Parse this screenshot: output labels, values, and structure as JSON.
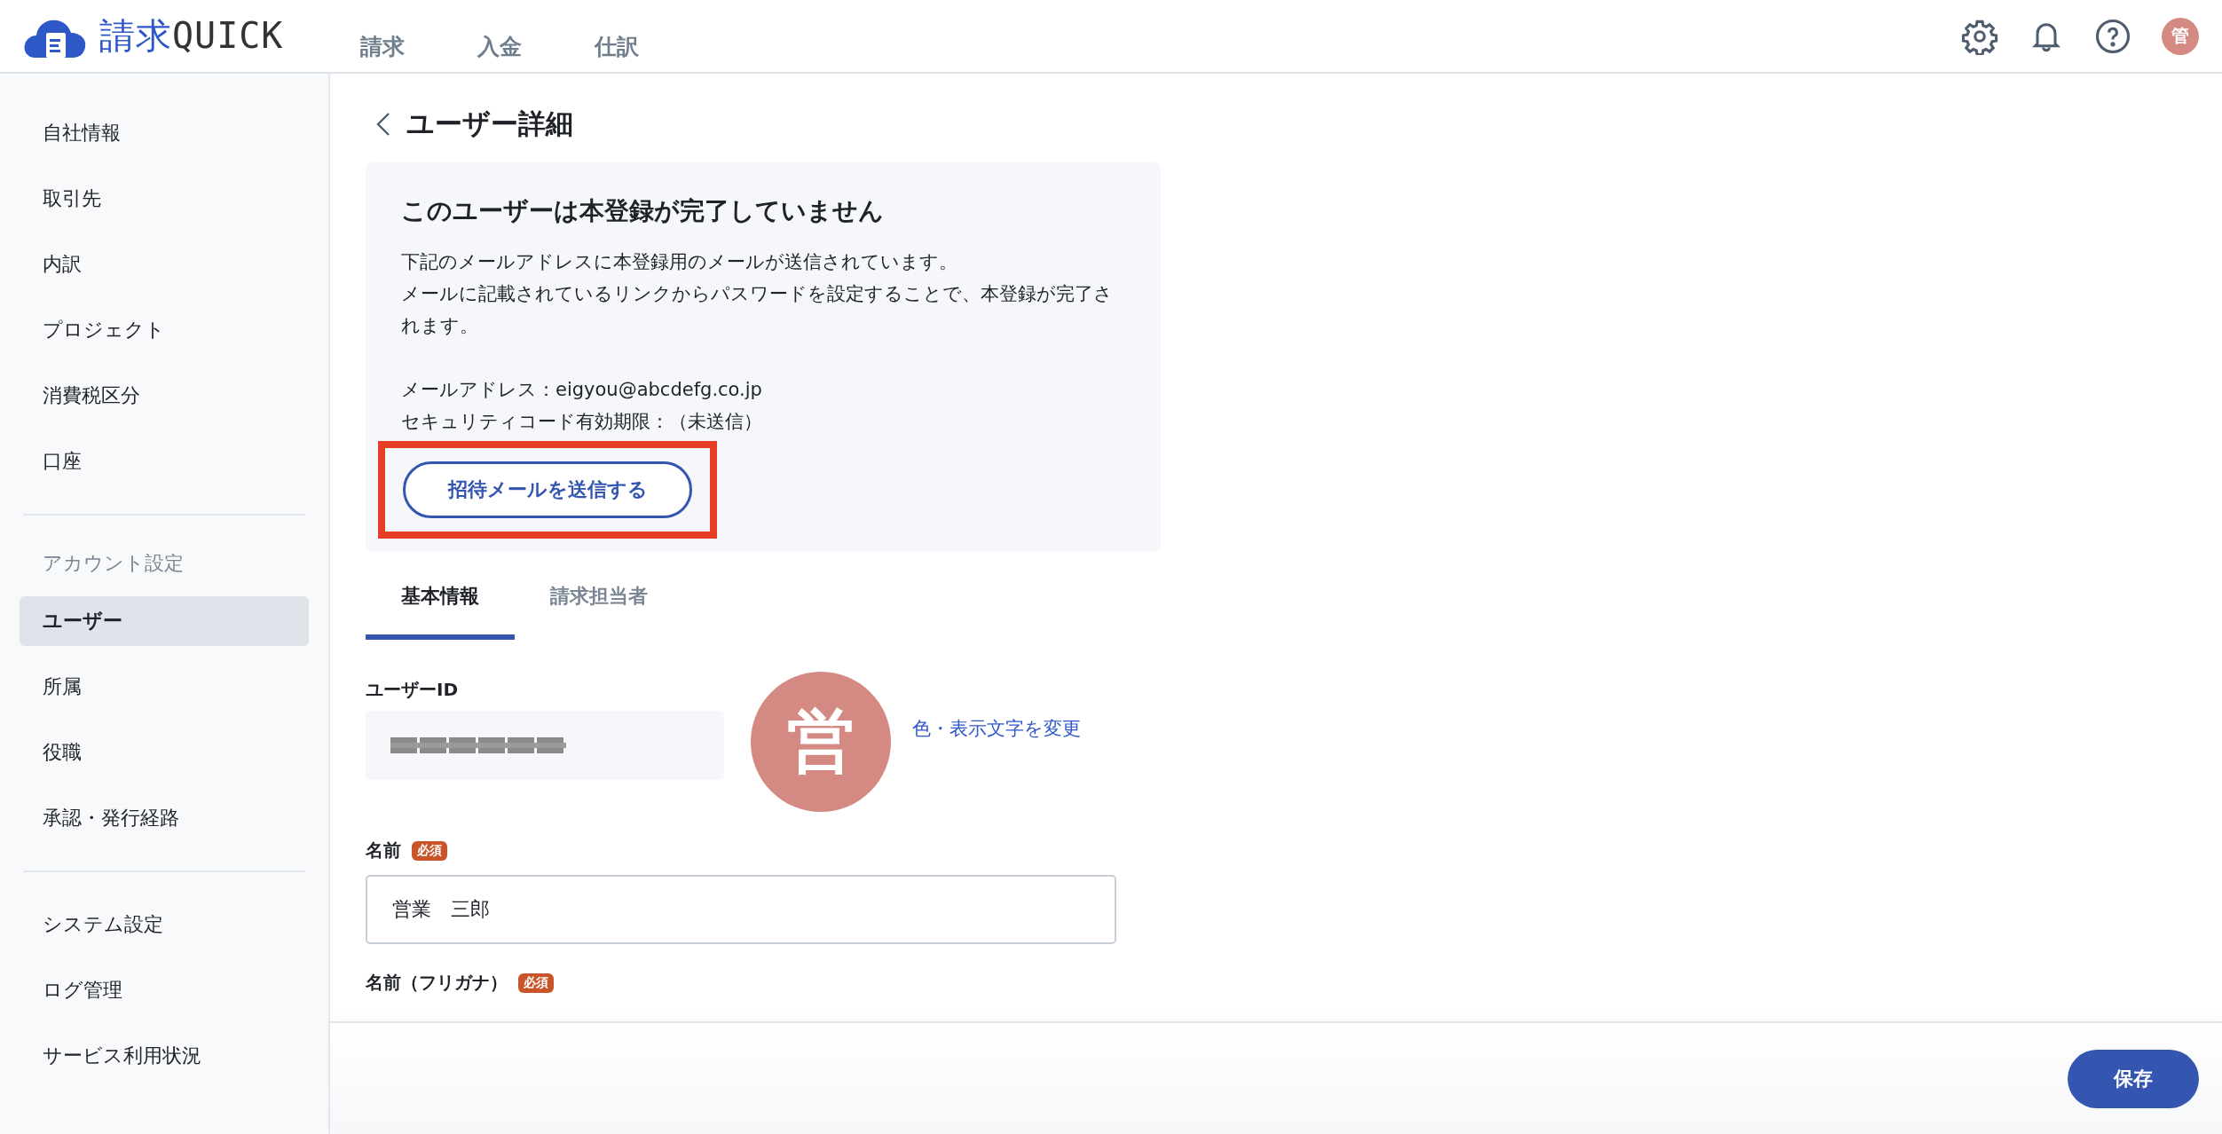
{
  "app": {
    "logo_text_1": "請求",
    "logo_text_2": "QUICK",
    "avatar": "管"
  },
  "nav": [
    {
      "label": "請求",
      "selected": false
    },
    {
      "label": "入金",
      "selected": false
    },
    {
      "label": "仕訳",
      "selected": false
    }
  ],
  "sidebar": {
    "groups": [
      {
        "items": [
          {
            "label": "自社情報",
            "selected": false
          },
          {
            "label": "取引先",
            "selected": false
          },
          {
            "label": "内訳",
            "selected": false
          },
          {
            "label": "プロジェクト",
            "selected": false
          },
          {
            "label": "消費税区分",
            "selected": false
          },
          {
            "label": "口座",
            "selected": false
          }
        ]
      },
      {
        "heading": "アカウント設定",
        "items": [
          {
            "label": "ユーザー",
            "selected": true
          },
          {
            "label": "所属",
            "selected": false
          },
          {
            "label": "役職",
            "selected": false
          },
          {
            "label": "承認・発行経路",
            "selected": false
          }
        ]
      },
      {
        "items": [
          {
            "label": "システム設定",
            "selected": false
          },
          {
            "label": "ログ管理",
            "selected": false
          },
          {
            "label": "サービス利用状況",
            "selected": false
          }
        ]
      }
    ]
  },
  "page": {
    "title": "ユーザー詳細"
  },
  "notice": {
    "title": "このユーザーは本登録が完了していません",
    "message": [
      "下記のメールアドレスに本登録用のメールが送信されています。",
      "メールに記載されているリンクからパスワードを設定することで、本登録が完了されます。"
    ],
    "details": [
      "メールアドレス：eigyou@abcdefg.co.jp",
      "セキュリティコード有効期限：（未送信）"
    ],
    "button": "招待メールを送信する",
    "highlighted": true
  },
  "tabs": [
    {
      "label": "基本情報",
      "selected": true
    },
    {
      "label": "請求担当者",
      "selected": false
    }
  ],
  "form": {
    "user_id": {
      "label": "ユーザーID",
      "redacted": true
    },
    "avatar": {
      "text": "営",
      "color": "#d48a82"
    },
    "avatar_link": "色・表示文字を変更",
    "fields": [
      {
        "label": "名前",
        "required": true,
        "badge": "必須",
        "value": "営業　三郎"
      },
      {
        "label": "名前（フリガナ）",
        "required": true,
        "badge": "必須"
      }
    ]
  },
  "footer": {
    "button": "保存"
  }
}
